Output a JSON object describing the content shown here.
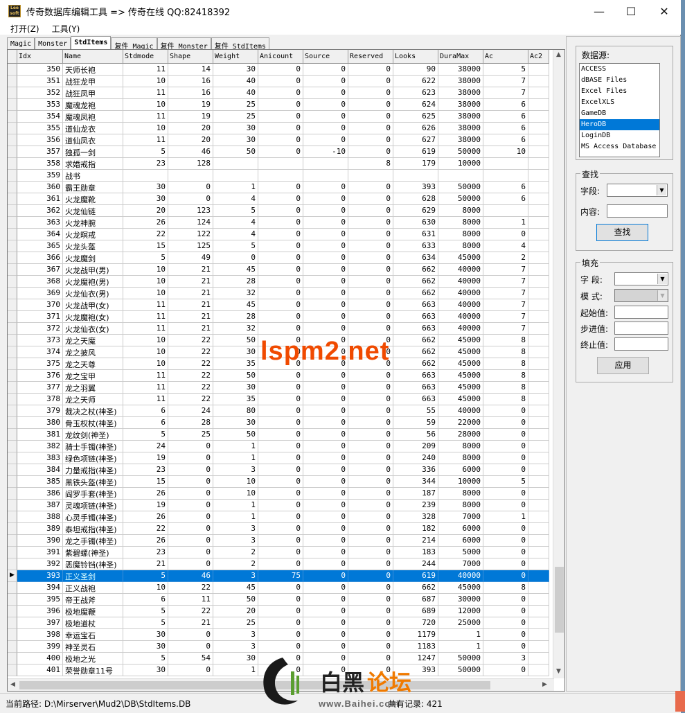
{
  "window": {
    "title": "传奇数据库编辑工具 => 传奇在线  QQ:82418392",
    "icon_text": "Lee soft"
  },
  "menu": [
    "打开(Z)",
    "工具(Y)"
  ],
  "tabs": [
    "Magic",
    "Monster",
    "StdItems",
    "复件 Magic",
    "复件 Monster",
    "复件 StdItems"
  ],
  "active_tab": "StdItems",
  "grid": {
    "columns": [
      "Idx",
      "Name",
      "Stdmode",
      "Shape",
      "Weight",
      "Anicount",
      "Source",
      "Reserved",
      "Looks",
      "DuraMax",
      "Ac",
      "Ac2"
    ],
    "rows": [
      [
        "350",
        "天师长袍",
        "11",
        "14",
        "30",
        "0",
        "0",
        "0",
        "90",
        "38000",
        "5",
        ""
      ],
      [
        "351",
        "战狂龙甲",
        "10",
        "16",
        "40",
        "0",
        "0",
        "0",
        "622",
        "38000",
        "7",
        ""
      ],
      [
        "352",
        "战狂凤甲",
        "11",
        "16",
        "40",
        "0",
        "0",
        "0",
        "623",
        "38000",
        "7",
        ""
      ],
      [
        "353",
        "魔魂龙袍",
        "10",
        "19",
        "25",
        "0",
        "0",
        "0",
        "624",
        "38000",
        "6",
        ""
      ],
      [
        "354",
        "魔魂凤袍",
        "11",
        "19",
        "25",
        "0",
        "0",
        "0",
        "625",
        "38000",
        "6",
        ""
      ],
      [
        "355",
        "道仙龙衣",
        "10",
        "20",
        "30",
        "0",
        "0",
        "0",
        "626",
        "38000",
        "6",
        ""
      ],
      [
        "356",
        "道仙凤衣",
        "11",
        "20",
        "30",
        "0",
        "0",
        "0",
        "627",
        "38000",
        "6",
        ""
      ],
      [
        "357",
        "独孤一剑",
        "5",
        "46",
        "50",
        "0",
        "-10",
        "0",
        "619",
        "50000",
        "10",
        ""
      ],
      [
        "358",
        "求婚戒指",
        "23",
        "128",
        "",
        "",
        "",
        "8",
        "179",
        "10000",
        "",
        ""
      ],
      [
        "359",
        "战书",
        "",
        "",
        "",
        "",
        "",
        "",
        "",
        "",
        "",
        ""
      ],
      [
        "360",
        "霸王勋章",
        "30",
        "0",
        "1",
        "0",
        "0",
        "0",
        "393",
        "50000",
        "6",
        ""
      ],
      [
        "361",
        "火龙魔靴",
        "30",
        "0",
        "4",
        "0",
        "0",
        "0",
        "628",
        "50000",
        "6",
        ""
      ],
      [
        "362",
        "火龙仙链",
        "20",
        "123",
        "5",
        "0",
        "0",
        "0",
        "629",
        "8000",
        "",
        ""
      ],
      [
        "363",
        "火龙神腕",
        "26",
        "124",
        "4",
        "0",
        "0",
        "0",
        "630",
        "8000",
        "1",
        ""
      ],
      [
        "364",
        "火龙暝戒",
        "22",
        "122",
        "4",
        "0",
        "0",
        "0",
        "631",
        "8000",
        "0",
        ""
      ],
      [
        "365",
        "火龙头盔",
        "15",
        "125",
        "5",
        "0",
        "0",
        "0",
        "633",
        "8000",
        "4",
        ""
      ],
      [
        "366",
        "火龙魔剑",
        "5",
        "49",
        "0",
        "0",
        "0",
        "0",
        "634",
        "45000",
        "2",
        ""
      ],
      [
        "367",
        "火龙战甲(男)",
        "10",
        "21",
        "45",
        "0",
        "0",
        "0",
        "662",
        "40000",
        "7",
        ""
      ],
      [
        "368",
        "火龙魔袍(男)",
        "10",
        "21",
        "28",
        "0",
        "0",
        "0",
        "662",
        "40000",
        "7",
        ""
      ],
      [
        "369",
        "火龙仙衣(男)",
        "10",
        "21",
        "32",
        "0",
        "0",
        "0",
        "662",
        "40000",
        "7",
        ""
      ],
      [
        "370",
        "火龙战甲(女)",
        "11",
        "21",
        "45",
        "0",
        "0",
        "0",
        "663",
        "40000",
        "7",
        ""
      ],
      [
        "371",
        "火龙魔袍(女)",
        "11",
        "21",
        "28",
        "0",
        "0",
        "0",
        "663",
        "40000",
        "7",
        ""
      ],
      [
        "372",
        "火龙仙衣(女)",
        "11",
        "21",
        "32",
        "0",
        "0",
        "0",
        "663",
        "40000",
        "7",
        ""
      ],
      [
        "373",
        "龙之天魔",
        "10",
        "22",
        "50",
        "0",
        "0",
        "0",
        "662",
        "45000",
        "8",
        ""
      ],
      [
        "374",
        "龙之披风",
        "10",
        "22",
        "30",
        "0",
        "0",
        "0",
        "662",
        "45000",
        "8",
        ""
      ],
      [
        "375",
        "龙之天尊",
        "10",
        "22",
        "35",
        "0",
        "0",
        "0",
        "662",
        "45000",
        "8",
        ""
      ],
      [
        "376",
        "龙之宝甲",
        "11",
        "22",
        "50",
        "0",
        "0",
        "0",
        "663",
        "45000",
        "8",
        ""
      ],
      [
        "377",
        "龙之羽翼",
        "11",
        "22",
        "30",
        "0",
        "0",
        "0",
        "663",
        "45000",
        "8",
        ""
      ],
      [
        "378",
        "龙之天师",
        "11",
        "22",
        "35",
        "0",
        "0",
        "0",
        "663",
        "45000",
        "8",
        ""
      ],
      [
        "379",
        "裁决之杖(神圣)",
        "6",
        "24",
        "80",
        "0",
        "0",
        "0",
        "55",
        "40000",
        "0",
        ""
      ],
      [
        "380",
        "骨玉权杖(神圣)",
        "6",
        "28",
        "30",
        "0",
        "0",
        "0",
        "59",
        "22000",
        "0",
        ""
      ],
      [
        "381",
        "龙纹剑(神圣)",
        "5",
        "25",
        "50",
        "0",
        "0",
        "0",
        "56",
        "28000",
        "0",
        ""
      ],
      [
        "382",
        "骑士手镯(神圣)",
        "24",
        "0",
        "1",
        "0",
        "0",
        "0",
        "209",
        "8000",
        "0",
        ""
      ],
      [
        "383",
        "绿色项链(神圣)",
        "19",
        "0",
        "1",
        "0",
        "0",
        "0",
        "240",
        "8000",
        "0",
        ""
      ],
      [
        "384",
        "力量戒指(神圣)",
        "23",
        "0",
        "3",
        "0",
        "0",
        "0",
        "336",
        "6000",
        "0",
        ""
      ],
      [
        "385",
        "黑铁头盔(神圣)",
        "15",
        "0",
        "10",
        "0",
        "0",
        "0",
        "344",
        "10000",
        "5",
        ""
      ],
      [
        "386",
        "阎罗手套(神圣)",
        "26",
        "0",
        "10",
        "0",
        "0",
        "0",
        "187",
        "8000",
        "0",
        ""
      ],
      [
        "387",
        "灵魂项链(神圣)",
        "19",
        "0",
        "1",
        "0",
        "0",
        "0",
        "239",
        "8000",
        "0",
        ""
      ],
      [
        "388",
        "心灵手镯(神圣)",
        "26",
        "0",
        "1",
        "0",
        "0",
        "0",
        "328",
        "7000",
        "1",
        ""
      ],
      [
        "389",
        "泰坦戒指(神圣)",
        "22",
        "0",
        "3",
        "0",
        "0",
        "0",
        "182",
        "6000",
        "0",
        ""
      ],
      [
        "390",
        "龙之手镯(神圣)",
        "26",
        "0",
        "3",
        "0",
        "0",
        "0",
        "214",
        "6000",
        "0",
        ""
      ],
      [
        "391",
        "紫碧螺(神圣)",
        "23",
        "0",
        "2",
        "0",
        "0",
        "0",
        "183",
        "5000",
        "0",
        ""
      ],
      [
        "392",
        "恶魔铃铛(神圣)",
        "21",
        "0",
        "2",
        "0",
        "0",
        "0",
        "244",
        "7000",
        "0",
        ""
      ],
      [
        "393",
        "正义圣剑",
        "5",
        "46",
        "3",
        "75",
        "0",
        "0",
        "619",
        "40000",
        "0",
        ""
      ],
      [
        "394",
        "正义战袍",
        "10",
        "22",
        "45",
        "0",
        "0",
        "0",
        "662",
        "45000",
        "8",
        ""
      ],
      [
        "395",
        "帝王战斧",
        "6",
        "11",
        "50",
        "0",
        "0",
        "0",
        "687",
        "30000",
        "0",
        ""
      ],
      [
        "396",
        "极地魔鞭",
        "5",
        "22",
        "20",
        "0",
        "0",
        "0",
        "689",
        "12000",
        "0",
        ""
      ],
      [
        "397",
        "极地道杖",
        "5",
        "21",
        "25",
        "0",
        "0",
        "0",
        "720",
        "25000",
        "0",
        ""
      ],
      [
        "398",
        "幸运宝石",
        "30",
        "0",
        "3",
        "0",
        "0",
        "0",
        "1179",
        "1",
        "0",
        ""
      ],
      [
        "399",
        "神圣灵石",
        "30",
        "0",
        "3",
        "0",
        "0",
        "0",
        "1183",
        "1",
        "0",
        ""
      ],
      [
        "400",
        "极地之光",
        "5",
        "54",
        "30",
        "0",
        "0",
        "0",
        "1247",
        "50000",
        "3",
        ""
      ],
      [
        "401",
        "荣誉勋章11号",
        "30",
        "0",
        "1",
        "0",
        "0",
        "0",
        "393",
        "50000",
        "0",
        ""
      ]
    ],
    "selected_row": 43
  },
  "side": {
    "datasource_title": "数据源:",
    "datasources": [
      "ACCESS",
      "dBASE Files",
      "Excel Files",
      "ExcelXLS",
      "GameDB",
      "HeroDB",
      "LoginDB",
      "MS Access Database"
    ],
    "selected_datasource": "HeroDB",
    "find_title": "查找",
    "find_field_label": "字段:",
    "find_content_label": "内容:",
    "find_button": "查找",
    "fill_title": "填充",
    "fill_field_label": "字  段:",
    "fill_mode_label": "模  式:",
    "fill_start_label": "起始值:",
    "fill_step_label": "步进值:",
    "fill_end_label": "终止值:",
    "apply_button": "应用"
  },
  "status": {
    "path_label": "当前路径:",
    "path": "D:\\Mirserver\\Mud2\\DB\\StdItems.DB",
    "count_label": "共有记录:",
    "count": "421"
  },
  "watermarks": {
    "lspm": "lspm2.net",
    "baihei_1": "白黑",
    "baihei_2": "论坛",
    "baihei_url": "www.Baihei.com"
  }
}
